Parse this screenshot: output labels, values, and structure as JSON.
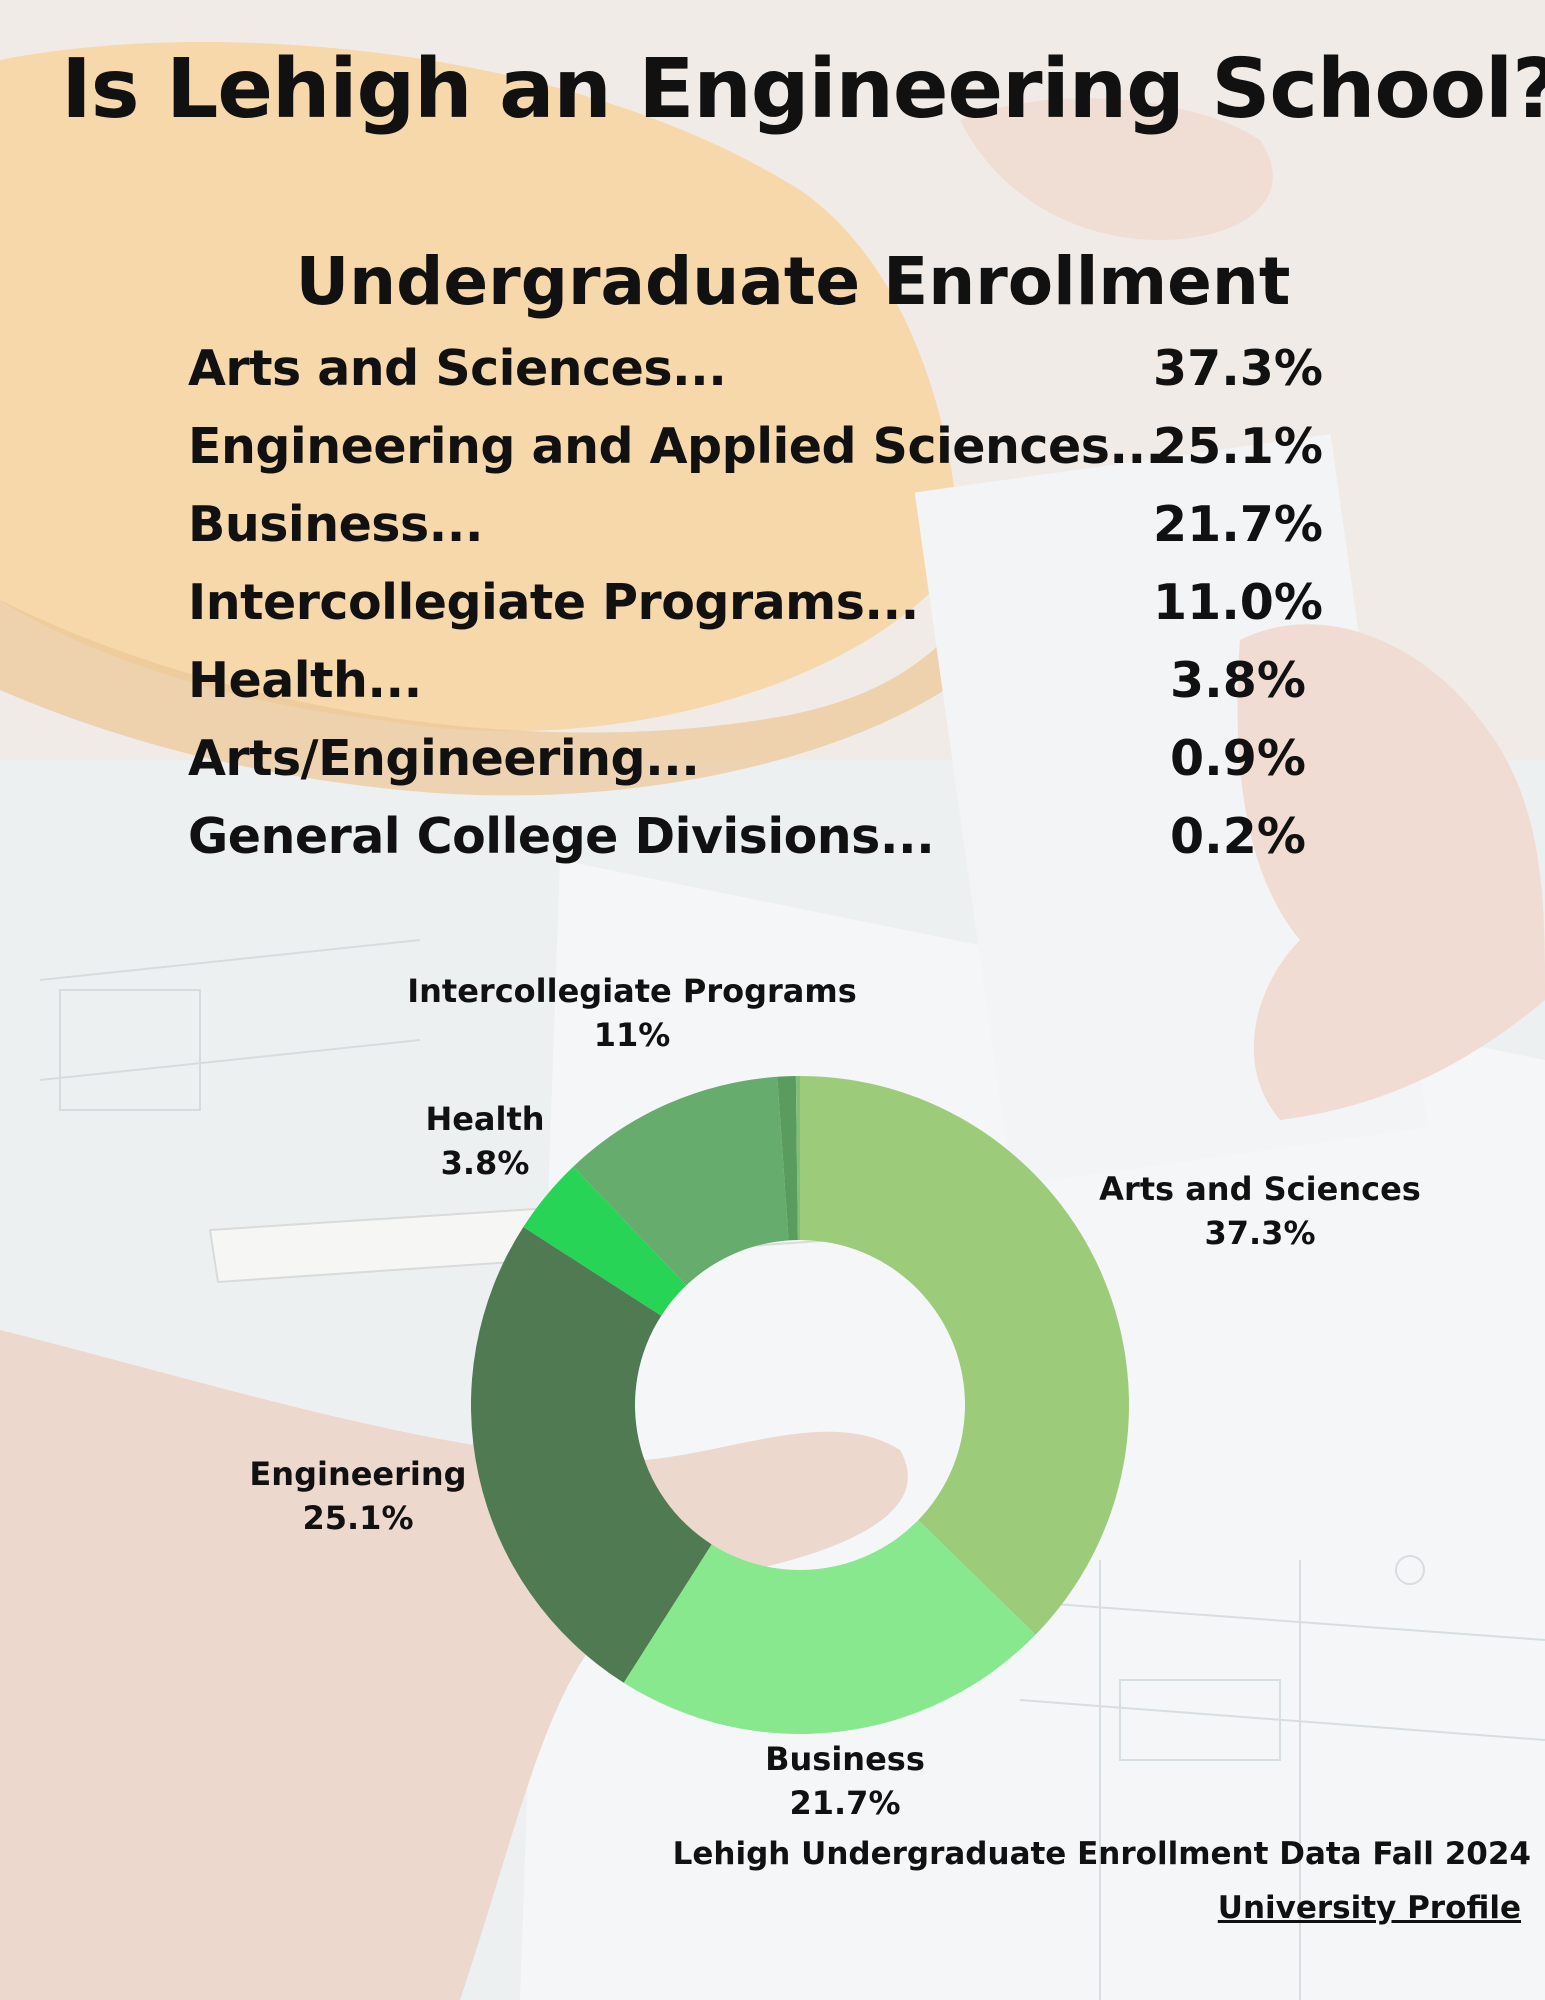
{
  "title": "Is Lehigh an Engineering School?",
  "subtitle": "Undergraduate Enrollment",
  "table": [
    {
      "name": "Arts and Sciences...",
      "pct": "37.3%"
    },
    {
      "name": "Engineering and Applied Sciences...",
      "pct": "25.1%"
    },
    {
      "name": "Business...",
      "pct": "21.7%"
    },
    {
      "name": "Intercollegiate Programs...",
      "pct": "11.0%"
    },
    {
      "name": "Health...",
      "pct": "3.8%"
    },
    {
      "name": "Arts/Engineering...",
      "pct": "0.9%"
    },
    {
      "name": "General College Divisions...",
      "pct": "0.2%"
    }
  ],
  "chart_data": {
    "type": "pie",
    "donut": true,
    "slices": [
      {
        "name": "Arts and Sciences",
        "value": 37.3,
        "label": "Arts and Sciences",
        "value_label": "37.3%",
        "color": "#9ccc7a"
      },
      {
        "name": "Business",
        "value": 21.7,
        "label": "Business",
        "value_label": "21.7%",
        "color": "#88e88e"
      },
      {
        "name": "Engineering",
        "value": 25.1,
        "label": "Engineering",
        "value_label": "25.1%",
        "color": "#4f7a52"
      },
      {
        "name": "Health",
        "value": 3.8,
        "label": "Health",
        "value_label": "3.8%",
        "color": "#27d455"
      },
      {
        "name": "Intercollegiate Programs",
        "value": 11.0,
        "label": "Intercollegiate Programs",
        "value_label": "11%",
        "color": "#66ac6c"
      },
      {
        "name": "Arts/Engineering",
        "value": 0.9,
        "label": "",
        "value_label": "",
        "color": "#5a9c5e"
      },
      {
        "name": "General College Divisions",
        "value": 0.2,
        "label": "",
        "value_label": "",
        "color": "#7fbf7a"
      }
    ]
  },
  "source": {
    "line": "Lehigh Undergraduate Enrollment Data Fall 2024",
    "link": "University Profile"
  }
}
